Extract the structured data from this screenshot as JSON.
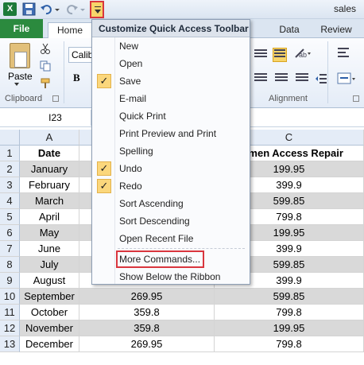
{
  "window": {
    "title": "sales"
  },
  "ribbon": {
    "tabs": [
      "File",
      "Home",
      "Data",
      "Review"
    ],
    "font_name": "Calib",
    "clipboard": {
      "paste_label": "Paste",
      "group_label": "Clipboard"
    },
    "bold_label": "B",
    "alignment_group_label": "Alignment"
  },
  "formula_bar": {
    "name_box": "I23"
  },
  "sheet": {
    "columns": [
      "A",
      "C"
    ],
    "header_row": {
      "row_num": "1",
      "a": "Date",
      "c": "Numen Access Repair"
    },
    "rows": [
      {
        "num": "2",
        "a": "January",
        "b": "",
        "c": "199.95"
      },
      {
        "num": "3",
        "a": "February",
        "b": "",
        "c": "399.9"
      },
      {
        "num": "4",
        "a": "March",
        "b": "",
        "c": "599.85"
      },
      {
        "num": "5",
        "a": "April",
        "b": "",
        "c": "799.8"
      },
      {
        "num": "6",
        "a": "May",
        "b": "",
        "c": "199.95"
      },
      {
        "num": "7",
        "a": "June",
        "b": "",
        "c": "399.9"
      },
      {
        "num": "8",
        "a": "July",
        "b": "",
        "c": "599.85"
      },
      {
        "num": "9",
        "a": "August",
        "b": "",
        "c": "399.9"
      },
      {
        "num": "10",
        "a": "September",
        "b": "269.95",
        "c": "599.85"
      },
      {
        "num": "11",
        "a": "October",
        "b": "359.8",
        "c": "799.8"
      },
      {
        "num": "12",
        "a": "November",
        "b": "359.8",
        "c": "199.95"
      },
      {
        "num": "13",
        "a": "December",
        "b": "269.95",
        "c": "799.8"
      }
    ]
  },
  "qat_menu": {
    "title": "Customize Quick Access Toolbar",
    "items": [
      {
        "label": "New",
        "checked": false
      },
      {
        "label": "Open",
        "checked": false
      },
      {
        "label": "Save",
        "checked": true
      },
      {
        "label": "E-mail",
        "checked": false
      },
      {
        "label": "Quick Print",
        "checked": false
      },
      {
        "label": "Print Preview and Print",
        "checked": false
      },
      {
        "label": "Spelling",
        "checked": false
      },
      {
        "label": "Undo",
        "checked": true
      },
      {
        "label": "Redo",
        "checked": true
      },
      {
        "label": "Sort Ascending",
        "checked": false
      },
      {
        "label": "Sort Descending",
        "checked": false
      },
      {
        "label": "Open Recent File",
        "checked": false
      },
      {
        "label": "More Commands...",
        "checked": false
      },
      {
        "label": "Show Below the Ribbon",
        "checked": false
      }
    ],
    "check_glyph": "✓"
  },
  "colors": {
    "file_tab": "#2b8a3e",
    "highlight_box": "#d9363e",
    "check_bg": "#fbd77c"
  }
}
